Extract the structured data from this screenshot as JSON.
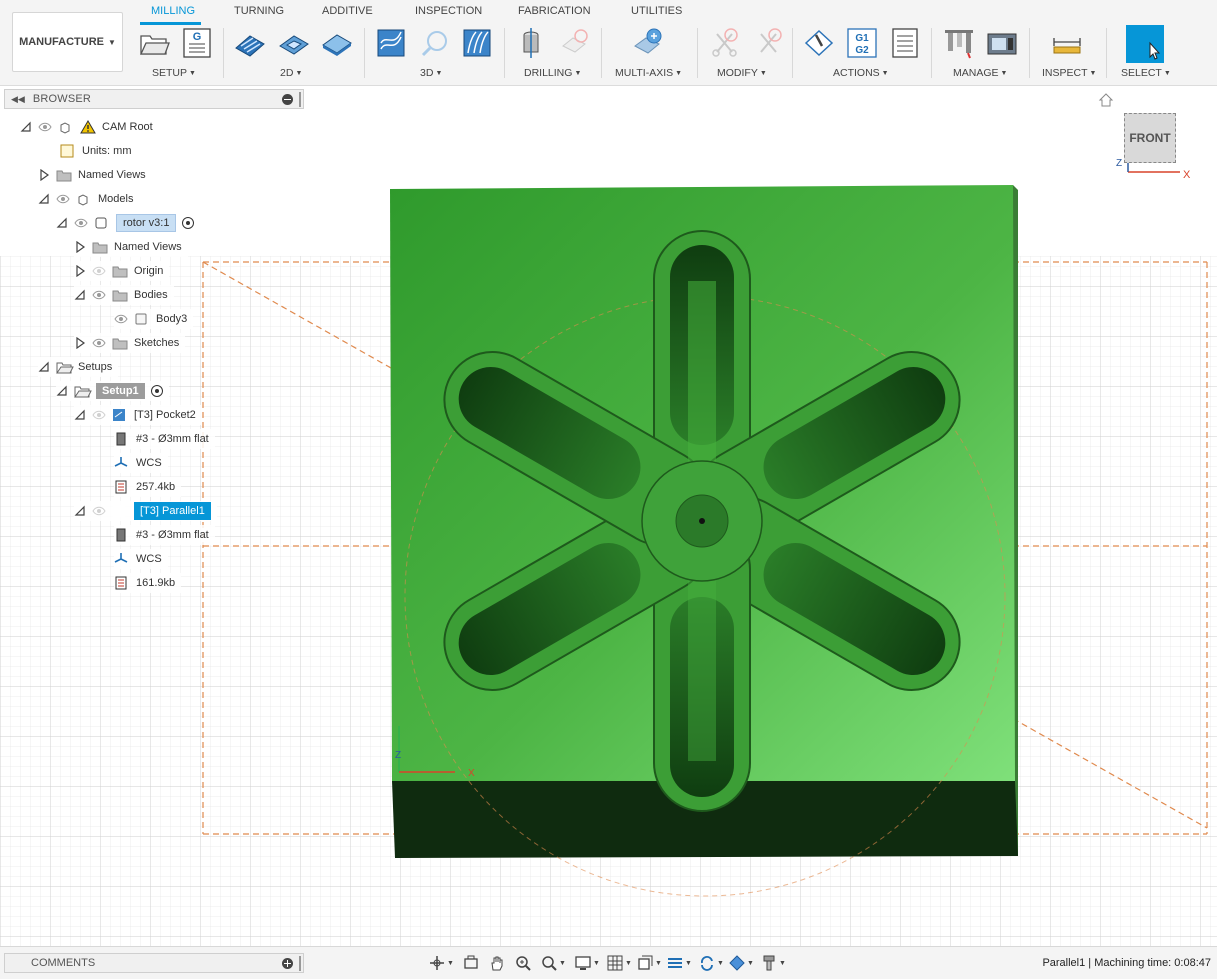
{
  "workspace": {
    "label": "MANUFACTURE"
  },
  "tabs": [
    "MILLING",
    "TURNING",
    "ADDITIVE",
    "INSPECTION",
    "FABRICATION",
    "UTILITIES"
  ],
  "groups": [
    "SETUP",
    "2D",
    "3D",
    "DRILLING",
    "MULTI-AXIS",
    "MODIFY",
    "ACTIONS",
    "MANAGE",
    "INSPECT",
    "SELECT"
  ],
  "toolbar_icons": {
    "gcode": "G",
    "g1g2_a": "G1",
    "g1g2_b": "G2"
  },
  "browser": {
    "title": "BROWSER",
    "items": [
      {
        "label": "CAM Root"
      },
      {
        "label": "Units: mm"
      },
      {
        "label": "Named Views"
      },
      {
        "label": "Models"
      },
      {
        "label": "rotor v3:1"
      },
      {
        "label": "Named Views"
      },
      {
        "label": "Origin"
      },
      {
        "label": "Bodies"
      },
      {
        "label": "Body3"
      },
      {
        "label": "Sketches"
      },
      {
        "label": "Setups"
      },
      {
        "label": "Setup1"
      },
      {
        "label": "[T3] Pocket2"
      },
      {
        "label": "#3 - Ø3mm flat"
      },
      {
        "label": "WCS"
      },
      {
        "label": "257.4kb"
      },
      {
        "label": "[T3] Parallel1"
      },
      {
        "label": "#3 - Ø3mm flat"
      },
      {
        "label": "WCS"
      },
      {
        "label": "161.9kb"
      }
    ]
  },
  "viewcube": {
    "label": "FRONT",
    "axis_x": "X",
    "axis_z": "Z"
  },
  "triad": {
    "x": "X",
    "z": "Z"
  },
  "comments": {
    "title": "COMMENTS"
  },
  "status": {
    "text": "Parallel1 | Machining time: 0:08:47"
  },
  "colors": {
    "accent": "#0696d7",
    "stock_green": "#3fa53a",
    "stock_dark": "#0f2b0f",
    "setup_box": "#e08a4e"
  }
}
